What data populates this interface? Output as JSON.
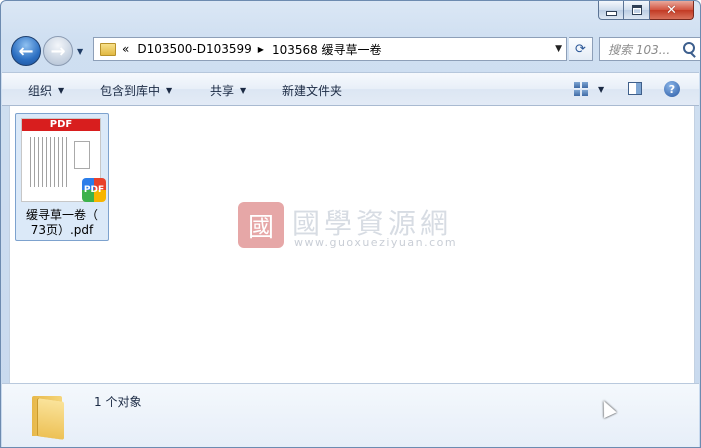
{
  "window": {
    "caption": {
      "min": "—",
      "max": "□",
      "close": "✕"
    }
  },
  "nav": {
    "back_glyph": "←",
    "forward_glyph": "→",
    "history_drop": "▼",
    "address": {
      "chevrons": "«",
      "segments": [
        "D103500-D103599",
        "103568 缓寻草一卷"
      ],
      "separator": "▶"
    },
    "refresh_glyph": "⟳",
    "search_placeholder": "搜索 103..."
  },
  "toolbar": {
    "organize": "组织",
    "include_in_library": "包含到库中",
    "share": "共享",
    "new_folder": "新建文件夹",
    "help": "?"
  },
  "files": [
    {
      "name_line1": "缓寻草一卷（",
      "name_line2": "73页）.pdf",
      "banner": "PDF",
      "badge": "PDF"
    }
  ],
  "watermark": {
    "seal": "國",
    "title": "國學資源網",
    "url": "www.guoxueziyuan.com"
  },
  "details": {
    "count_text": "1 个对象"
  }
}
